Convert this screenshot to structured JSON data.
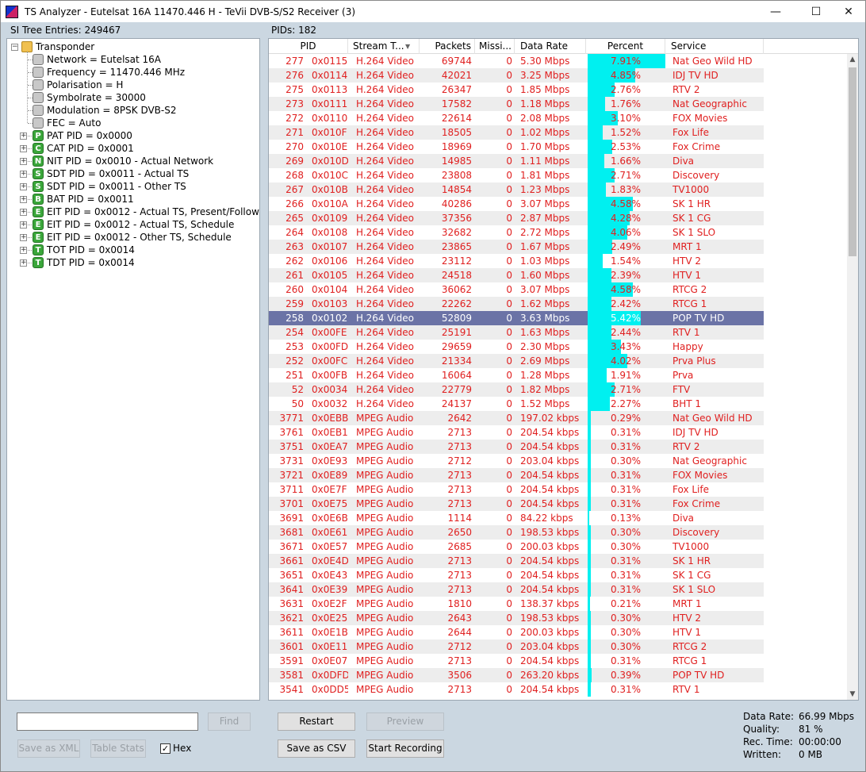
{
  "window": {
    "title": "TS Analyzer - Eutelsat 16A 11470.446 H - TeVii DVB-S/S2 Receiver (3)",
    "minimize": "—",
    "maximize": "☐",
    "close": "✕"
  },
  "left_panel": {
    "label": "SI Tree Entries: 249467"
  },
  "right_panel": {
    "label": "PIDs: 182"
  },
  "tree": {
    "root": "Transponder",
    "properties": [
      "Network = Eutelsat 16A",
      "Frequency = 11470.446 MHz",
      "Polarisation = H",
      "Symbolrate = 30000",
      "Modulation = 8PSK DVB-S2",
      "FEC = Auto"
    ],
    "tables": [
      {
        "letter": "P",
        "label": "PAT PID = 0x0000"
      },
      {
        "letter": "C",
        "label": "CAT PID = 0x0001"
      },
      {
        "letter": "N",
        "label": "NIT PID = 0x0010 - Actual Network"
      },
      {
        "letter": "S",
        "label": "SDT PID = 0x0011 - Actual TS"
      },
      {
        "letter": "S",
        "label": "SDT PID = 0x0011 - Other TS"
      },
      {
        "letter": "B",
        "label": "BAT PID = 0x0011"
      },
      {
        "letter": "E",
        "label": "EIT PID = 0x0012 - Actual TS, Present/Following"
      },
      {
        "letter": "E",
        "label": "EIT PID = 0x0012 - Actual TS, Schedule"
      },
      {
        "letter": "E",
        "label": "EIT PID = 0x0012 - Other TS, Schedule"
      },
      {
        "letter": "T",
        "label": "TOT PID = 0x0014"
      },
      {
        "letter": "T",
        "label": "TDT PID = 0x0014"
      }
    ]
  },
  "grid": {
    "columns": {
      "pid": "PID",
      "stream_type": "Stream T...",
      "packets": "Packets",
      "missing": "Missi...",
      "data_rate": "Data Rate",
      "percent": "Percent",
      "service": "Service"
    },
    "selected_pid": "258",
    "rows": [
      {
        "pid": "277",
        "hex": "0x0115",
        "type": "H.264 Video",
        "packets": "69744",
        "missing": "0",
        "rate": "5.30 Mbps",
        "percent": "7.91%",
        "service": "Nat Geo Wild HD"
      },
      {
        "pid": "276",
        "hex": "0x0114",
        "type": "H.264 Video",
        "packets": "42021",
        "missing": "0",
        "rate": "3.25 Mbps",
        "percent": "4.85%",
        "service": "IDJ TV HD"
      },
      {
        "pid": "275",
        "hex": "0x0113",
        "type": "H.264 Video",
        "packets": "26347",
        "missing": "0",
        "rate": "1.85 Mbps",
        "percent": "2.76%",
        "service": "RTV 2"
      },
      {
        "pid": "273",
        "hex": "0x0111",
        "type": "H.264 Video",
        "packets": "17582",
        "missing": "0",
        "rate": "1.18 Mbps",
        "percent": "1.76%",
        "service": "Nat Geographic"
      },
      {
        "pid": "272",
        "hex": "0x0110",
        "type": "H.264 Video",
        "packets": "22614",
        "missing": "0",
        "rate": "2.08 Mbps",
        "percent": "3.10%",
        "service": "FOX Movies"
      },
      {
        "pid": "271",
        "hex": "0x010F",
        "type": "H.264 Video",
        "packets": "18505",
        "missing": "0",
        "rate": "1.02 Mbps",
        "percent": "1.52%",
        "service": "Fox Life"
      },
      {
        "pid": "270",
        "hex": "0x010E",
        "type": "H.264 Video",
        "packets": "18969",
        "missing": "0",
        "rate": "1.70 Mbps",
        "percent": "2.53%",
        "service": "Fox Crime"
      },
      {
        "pid": "269",
        "hex": "0x010D",
        "type": "H.264 Video",
        "packets": "14985",
        "missing": "0",
        "rate": "1.11 Mbps",
        "percent": "1.66%",
        "service": "Diva"
      },
      {
        "pid": "268",
        "hex": "0x010C",
        "type": "H.264 Video",
        "packets": "23808",
        "missing": "0",
        "rate": "1.81 Mbps",
        "percent": "2.71%",
        "service": "Discovery"
      },
      {
        "pid": "267",
        "hex": "0x010B",
        "type": "H.264 Video",
        "packets": "14854",
        "missing": "0",
        "rate": "1.23 Mbps",
        "percent": "1.83%",
        "service": "TV1000"
      },
      {
        "pid": "266",
        "hex": "0x010A",
        "type": "H.264 Video",
        "packets": "40286",
        "missing": "0",
        "rate": "3.07 Mbps",
        "percent": "4.58%",
        "service": "SK 1 HR"
      },
      {
        "pid": "265",
        "hex": "0x0109",
        "type": "H.264 Video",
        "packets": "37356",
        "missing": "0",
        "rate": "2.87 Mbps",
        "percent": "4.28%",
        "service": "SK 1 CG"
      },
      {
        "pid": "264",
        "hex": "0x0108",
        "type": "H.264 Video",
        "packets": "32682",
        "missing": "0",
        "rate": "2.72 Mbps",
        "percent": "4.06%",
        "service": "SK 1 SLO"
      },
      {
        "pid": "263",
        "hex": "0x0107",
        "type": "H.264 Video",
        "packets": "23865",
        "missing": "0",
        "rate": "1.67 Mbps",
        "percent": "2.49%",
        "service": "MRT 1"
      },
      {
        "pid": "262",
        "hex": "0x0106",
        "type": "H.264 Video",
        "packets": "23112",
        "missing": "0",
        "rate": "1.03 Mbps",
        "percent": "1.54%",
        "service": "HTV 2"
      },
      {
        "pid": "261",
        "hex": "0x0105",
        "type": "H.264 Video",
        "packets": "24518",
        "missing": "0",
        "rate": "1.60 Mbps",
        "percent": "2.39%",
        "service": "HTV 1"
      },
      {
        "pid": "260",
        "hex": "0x0104",
        "type": "H.264 Video",
        "packets": "36062",
        "missing": "0",
        "rate": "3.07 Mbps",
        "percent": "4.58%",
        "service": "RTCG 2"
      },
      {
        "pid": "259",
        "hex": "0x0103",
        "type": "H.264 Video",
        "packets": "22262",
        "missing": "0",
        "rate": "1.62 Mbps",
        "percent": "2.42%",
        "service": "RTCG 1"
      },
      {
        "pid": "258",
        "hex": "0x0102",
        "type": "H.264 Video",
        "packets": "52809",
        "missing": "0",
        "rate": "3.63 Mbps",
        "percent": "5.42%",
        "service": "POP TV HD"
      },
      {
        "pid": "254",
        "hex": "0x00FE",
        "type": "H.264 Video",
        "packets": "25191",
        "missing": "0",
        "rate": "1.63 Mbps",
        "percent": "2.44%",
        "service": "RTV 1"
      },
      {
        "pid": "253",
        "hex": "0x00FD",
        "type": "H.264 Video",
        "packets": "29659",
        "missing": "0",
        "rate": "2.30 Mbps",
        "percent": "3.43%",
        "service": "Happy"
      },
      {
        "pid": "252",
        "hex": "0x00FC",
        "type": "H.264 Video",
        "packets": "21334",
        "missing": "0",
        "rate": "2.69 Mbps",
        "percent": "4.02%",
        "service": "Prva Plus"
      },
      {
        "pid": "251",
        "hex": "0x00FB",
        "type": "H.264 Video",
        "packets": "16064",
        "missing": "0",
        "rate": "1.28 Mbps",
        "percent": "1.91%",
        "service": "Prva"
      },
      {
        "pid": "52",
        "hex": "0x0034",
        "type": "H.264 Video",
        "packets": "22779",
        "missing": "0",
        "rate": "1.82 Mbps",
        "percent": "2.71%",
        "service": "FTV"
      },
      {
        "pid": "50",
        "hex": "0x0032",
        "type": "H.264 Video",
        "packets": "24137",
        "missing": "0",
        "rate": "1.52 Mbps",
        "percent": "2.27%",
        "service": "BHT 1"
      },
      {
        "pid": "3771",
        "hex": "0x0EBB",
        "type": "MPEG Audio",
        "packets": "2642",
        "missing": "0",
        "rate": "197.02 kbps",
        "percent": "0.29%",
        "service": "Nat Geo Wild HD"
      },
      {
        "pid": "3761",
        "hex": "0x0EB1",
        "type": "MPEG Audio",
        "packets": "2713",
        "missing": "0",
        "rate": "204.54 kbps",
        "percent": "0.31%",
        "service": "IDJ TV HD"
      },
      {
        "pid": "3751",
        "hex": "0x0EA7",
        "type": "MPEG Audio",
        "packets": "2713",
        "missing": "0",
        "rate": "204.54 kbps",
        "percent": "0.31%",
        "service": "RTV 2"
      },
      {
        "pid": "3731",
        "hex": "0x0E93",
        "type": "MPEG Audio",
        "packets": "2712",
        "missing": "0",
        "rate": "203.04 kbps",
        "percent": "0.30%",
        "service": "Nat Geographic"
      },
      {
        "pid": "3721",
        "hex": "0x0E89",
        "type": "MPEG Audio",
        "packets": "2713",
        "missing": "0",
        "rate": "204.54 kbps",
        "percent": "0.31%",
        "service": "FOX Movies"
      },
      {
        "pid": "3711",
        "hex": "0x0E7F",
        "type": "MPEG Audio",
        "packets": "2713",
        "missing": "0",
        "rate": "204.54 kbps",
        "percent": "0.31%",
        "service": "Fox Life"
      },
      {
        "pid": "3701",
        "hex": "0x0E75",
        "type": "MPEG Audio",
        "packets": "2713",
        "missing": "0",
        "rate": "204.54 kbps",
        "percent": "0.31%",
        "service": "Fox Crime"
      },
      {
        "pid": "3691",
        "hex": "0x0E6B",
        "type": "MPEG Audio",
        "packets": "1114",
        "missing": "0",
        "rate": "84.22 kbps",
        "percent": "0.13%",
        "service": "Diva"
      },
      {
        "pid": "3681",
        "hex": "0x0E61",
        "type": "MPEG Audio",
        "packets": "2650",
        "missing": "0",
        "rate": "198.53 kbps",
        "percent": "0.30%",
        "service": "Discovery"
      },
      {
        "pid": "3671",
        "hex": "0x0E57",
        "type": "MPEG Audio",
        "packets": "2685",
        "missing": "0",
        "rate": "200.03 kbps",
        "percent": "0.30%",
        "service": "TV1000"
      },
      {
        "pid": "3661",
        "hex": "0x0E4D",
        "type": "MPEG Audio",
        "packets": "2713",
        "missing": "0",
        "rate": "204.54 kbps",
        "percent": "0.31%",
        "service": "SK 1 HR"
      },
      {
        "pid": "3651",
        "hex": "0x0E43",
        "type": "MPEG Audio",
        "packets": "2713",
        "missing": "0",
        "rate": "204.54 kbps",
        "percent": "0.31%",
        "service": "SK 1 CG"
      },
      {
        "pid": "3641",
        "hex": "0x0E39",
        "type": "MPEG Audio",
        "packets": "2713",
        "missing": "0",
        "rate": "204.54 kbps",
        "percent": "0.31%",
        "service": "SK 1 SLO"
      },
      {
        "pid": "3631",
        "hex": "0x0E2F",
        "type": "MPEG Audio",
        "packets": "1810",
        "missing": "0",
        "rate": "138.37 kbps",
        "percent": "0.21%",
        "service": "MRT 1"
      },
      {
        "pid": "3621",
        "hex": "0x0E25",
        "type": "MPEG Audio",
        "packets": "2643",
        "missing": "0",
        "rate": "198.53 kbps",
        "percent": "0.30%",
        "service": "HTV 2"
      },
      {
        "pid": "3611",
        "hex": "0x0E1B",
        "type": "MPEG Audio",
        "packets": "2644",
        "missing": "0",
        "rate": "200.03 kbps",
        "percent": "0.30%",
        "service": "HTV 1"
      },
      {
        "pid": "3601",
        "hex": "0x0E11",
        "type": "MPEG Audio",
        "packets": "2712",
        "missing": "0",
        "rate": "203.04 kbps",
        "percent": "0.30%",
        "service": "RTCG 2"
      },
      {
        "pid": "3591",
        "hex": "0x0E07",
        "type": "MPEG Audio",
        "packets": "2713",
        "missing": "0",
        "rate": "204.54 kbps",
        "percent": "0.31%",
        "service": "RTCG 1"
      },
      {
        "pid": "3581",
        "hex": "0x0DFD",
        "type": "MPEG Audio",
        "packets": "3506",
        "missing": "0",
        "rate": "263.20 kbps",
        "percent": "0.39%",
        "service": "POP TV HD"
      },
      {
        "pid": "3541",
        "hex": "0x0DD5",
        "type": "MPEG Audio",
        "packets": "2713",
        "missing": "0",
        "rate": "204.54 kbps",
        "percent": "0.31%",
        "service": "RTV 1"
      }
    ]
  },
  "bottom_left": {
    "find_placeholder": "",
    "find_button": "Find",
    "save_xml": "Save as XML",
    "table_stats": "Table Stats",
    "hex_label": "Hex",
    "hex_checked": true
  },
  "bottom_mid": {
    "restart": "Restart",
    "preview": "Preview",
    "save_csv": "Save as CSV",
    "start_recording": "Start Recording"
  },
  "stats": {
    "data_rate_label": "Data Rate:",
    "data_rate_value": "66.99 Mbps",
    "quality_label": "Quality:",
    "quality_value": "81 %",
    "rec_time_label": "Rec. Time:",
    "rec_time_value": "00:00:00",
    "written_label": "Written:",
    "written_value": "0 MB"
  },
  "colors": {
    "row_text": "#e02020",
    "percent_bar": "#00f0f0",
    "selected_row": "#6b73a6",
    "icon_green": "#3aa63a"
  }
}
